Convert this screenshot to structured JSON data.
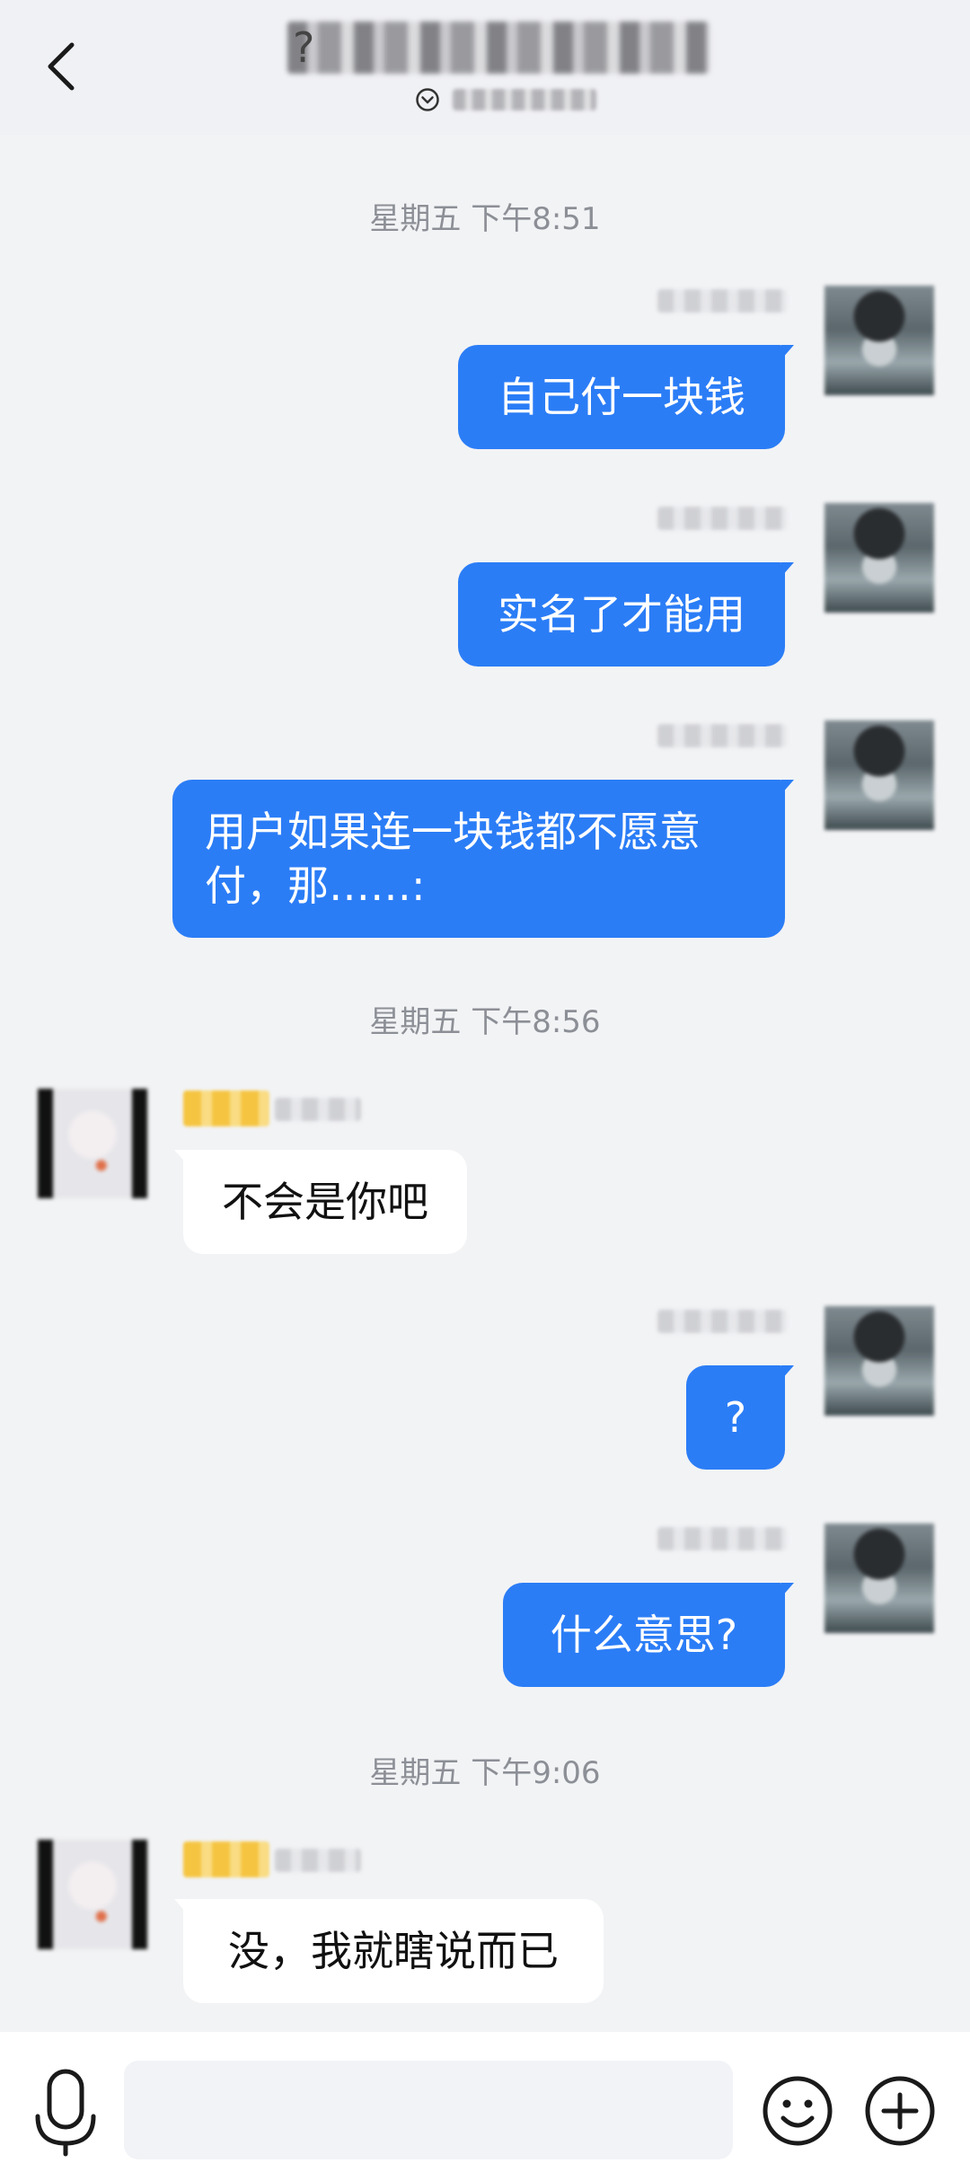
{
  "header": {
    "title_icon": "?"
  },
  "timestamps": [
    "星期五 下午8:51",
    "星期五 下午8:56",
    "星期五 下午9:06"
  ],
  "messages": {
    "m1": "自己付一块钱",
    "m2": "实名了才能用",
    "m3": "用户如果连一块钱都不愿意\n付，那……:",
    "m4": "不会是你吧",
    "m5": "?",
    "m6": "什么意思?",
    "m7": "没，我就瞎说而已"
  },
  "colors": {
    "outgoing_bubble": "#2b7df6",
    "incoming_bubble": "#ffffff",
    "background": "#f2f3f5"
  },
  "icons": [
    "back-arrow",
    "chevron-down-circle",
    "microphone",
    "emoji",
    "plus-circle"
  ]
}
